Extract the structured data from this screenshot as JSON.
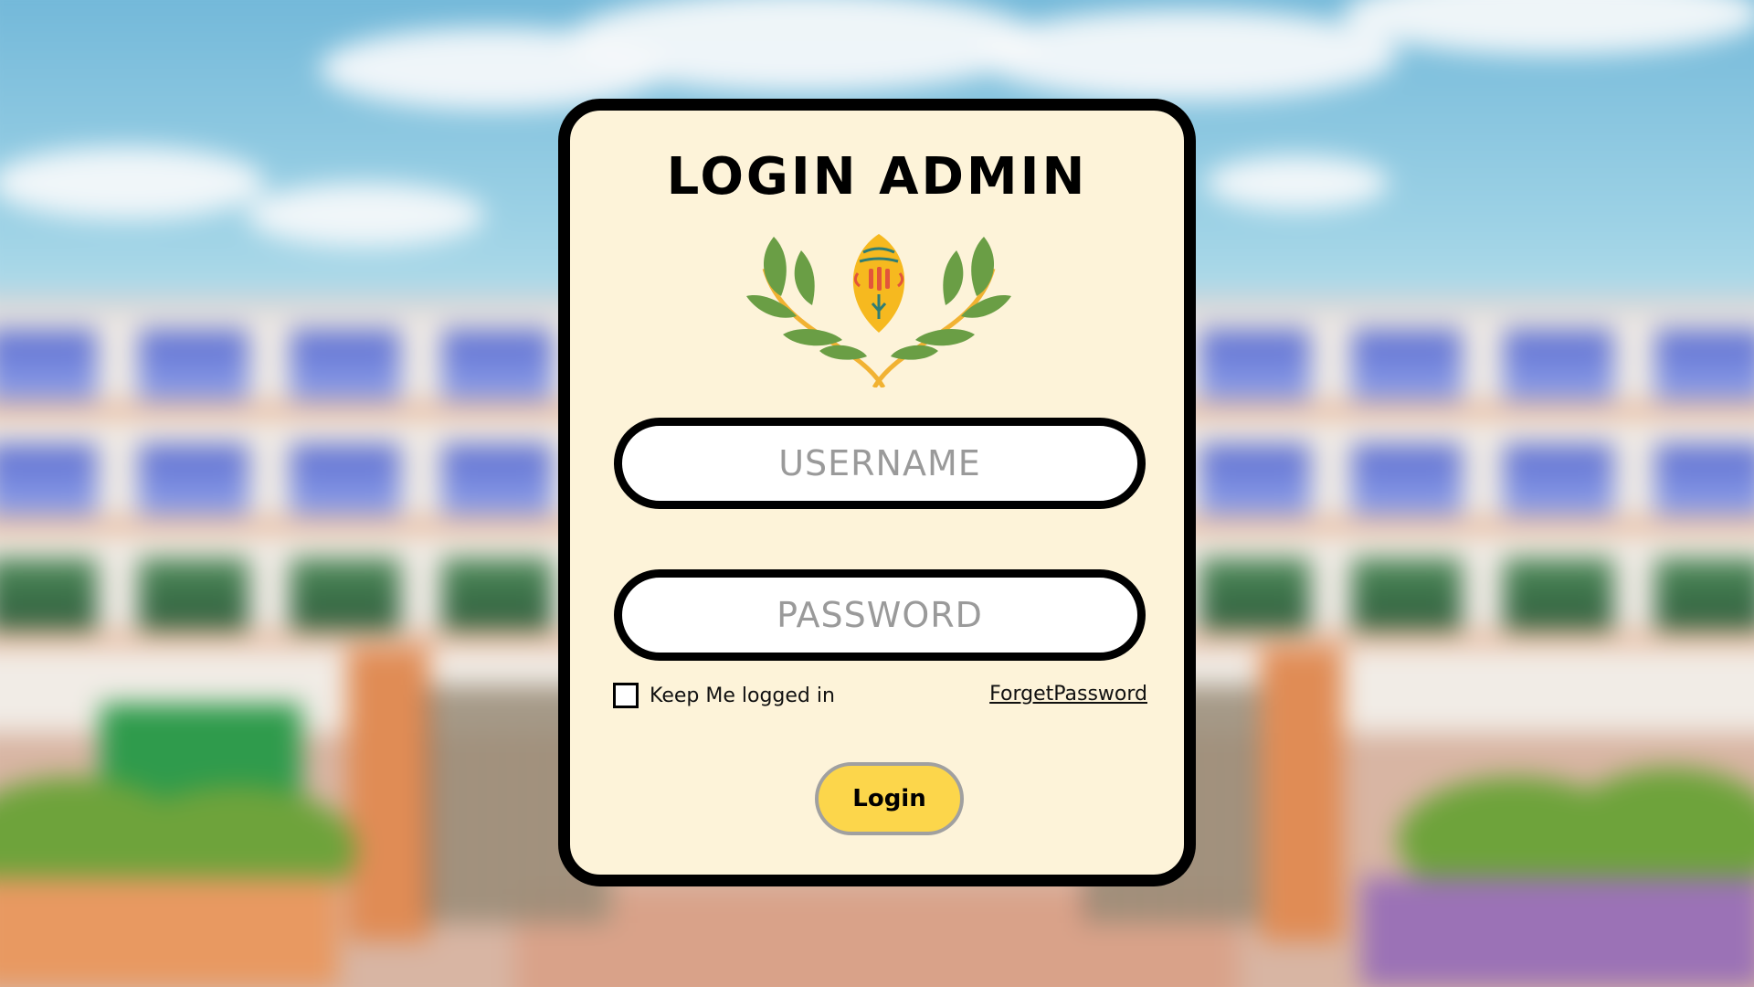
{
  "login": {
    "title": "LOGIN ADMIN",
    "username_placeholder": "USERNAME",
    "password_placeholder": "PASSWORD",
    "remember_label": "Keep Me logged in",
    "remember_checked": false,
    "forget_password_label": "ForgetPassword",
    "login_button_label": "Login"
  },
  "colors": {
    "card_background": "#fdf3d9",
    "card_border": "#000000",
    "button_yellow": "#fcd64b",
    "emblem_orange": "#f6b91f",
    "emblem_leaf_green": "#6a9e45"
  },
  "icons": {
    "emblem": "school-crest-with-laurel-icon"
  }
}
